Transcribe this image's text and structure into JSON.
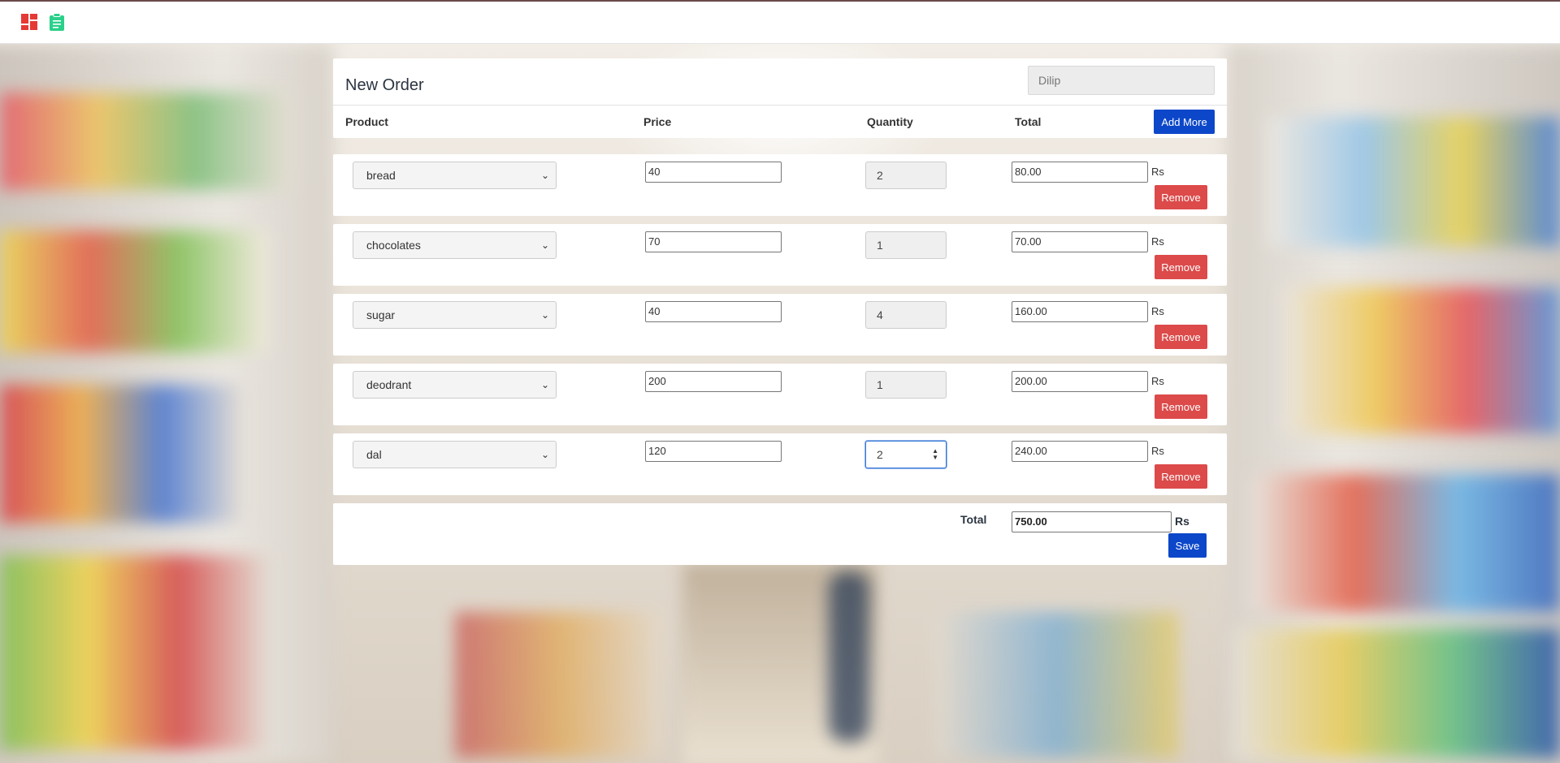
{
  "app": {
    "nav_icons": [
      "dashboard-icon",
      "clipboard-icon"
    ],
    "colors": {
      "dashboard_icon": "#e53935",
      "clipboard_icon": "#2bd08a"
    }
  },
  "order": {
    "title": "New Order",
    "customer_placeholder": "Dilip",
    "columns": {
      "product": "Product",
      "price": "Price",
      "quantity": "Quantity",
      "total": "Total"
    },
    "add_more_label": "Add More",
    "remove_label": "Remove",
    "currency": "Rs",
    "items": [
      {
        "product": "bread",
        "price": "40",
        "quantity": "2",
        "total": "80.00"
      },
      {
        "product": "chocolates",
        "price": "70",
        "quantity": "1",
        "total": "70.00"
      },
      {
        "product": "sugar",
        "price": "40",
        "quantity": "4",
        "total": "160.00"
      },
      {
        "product": "deodrant",
        "price": "200",
        "quantity": "1",
        "total": "200.00"
      },
      {
        "product": "dal",
        "price": "120",
        "quantity": "2",
        "total": "240.00"
      }
    ],
    "grand_total_label": "Total",
    "grand_total": "750.00",
    "save_label": "Save"
  }
}
